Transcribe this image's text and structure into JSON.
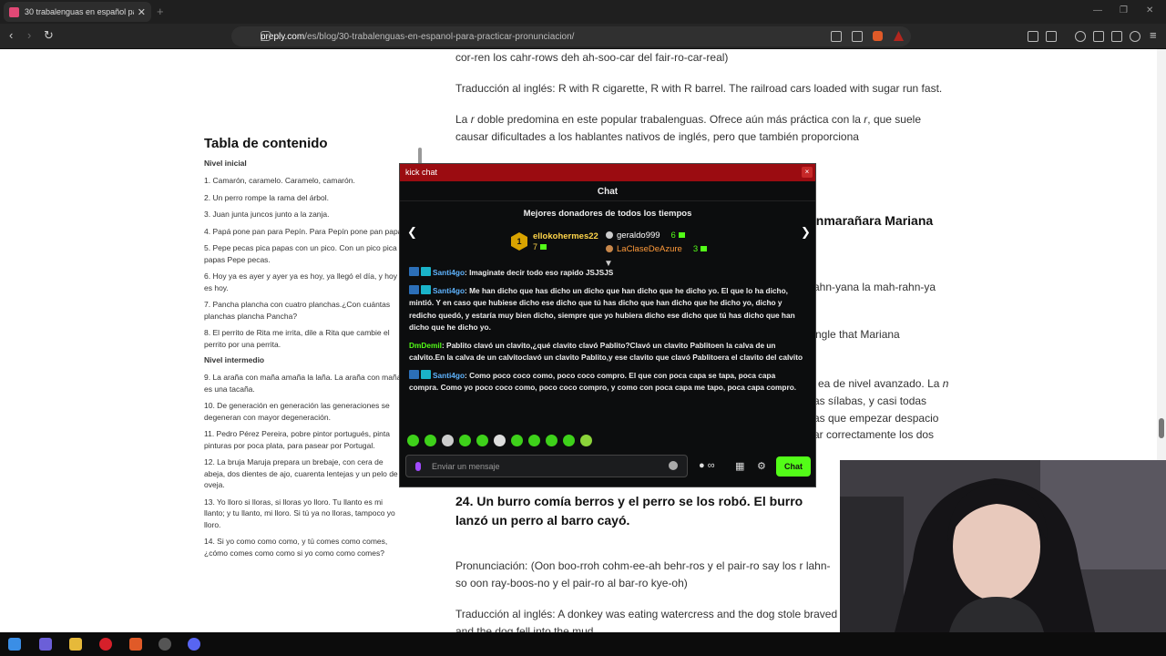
{
  "browser": {
    "tab_title": "30 trabalenguas en español para...",
    "url_domain": "preply.com",
    "url_path": "/es/blog/30-trabalenguas-en-espanol-para-practicar-pronunciacion/"
  },
  "toc": {
    "heading": "Tabla de contenido",
    "section1": "Nivel inicial",
    "items1": [
      "1. Camarón, caramelo. Caramelo, camarón.",
      "2. Un perro rompe la rama del árbol.",
      "3. Juan junta juncos junto a la zanja.",
      "4. Papá pone pan para Pepín. Para Pepín pone pan papá.",
      "5. Pepe pecas pica papas con un pico. Con un pico pica papas Pepe pecas.",
      "6. Hoy ya es ayer y ayer ya es hoy, ya llegó el día, y hoy es hoy.",
      "7. Pancha plancha con cuatro planchas.¿Con cuántas planchas plancha Pancha?",
      "8. El perrito de Rita me irrita, dile a Rita que cambie el perrito por una perrita."
    ],
    "section2": "Nivel intermedio",
    "items2": [
      "9. La araña con maña amaña la laña. La araña con maña es una tacaña.",
      "10. De generación en generación las generaciones se degeneran con mayor degeneración.",
      "11. Pedro Pérez Pereira, pobre pintor portugués, pinta pinturas por poca plata, para pasear por Portugal.",
      "12. La bruja Maruja prepara un brebaje, con cera de abeja, dos dientes de ajo, cuarenta lentejas y un pelo de oveja.",
      "13. Yo lloro si lloras, si lloras yo lloro. Tu llanto es mi llanto; y tu llanto, mi lloro. Si tú ya no lloras, tampoco yo lloro.",
      "14. Si yo como como como, y tú comes como comes, ¿cómo comes como como si yo como como comes?"
    ]
  },
  "article": {
    "p1": "cor-ren los cahr-rows deh ah-soo-car del fair-ro-car-real)",
    "p2": "Traducción al inglés: R with R cigarette, R with R barrel. The railroad cars loaded with sugar run fast.",
    "p3a": "La ",
    "p3b": "r",
    "p3c": " doble predomina en este popular trabalenguas. Ofrece aún más práctica con la ",
    "p3d": "r",
    "p3e": ", que suele causar dificultades a los hablantes nativos de inglés, pero que también proporciona",
    "frag_h": "enmarañara Mariana",
    "frag1": "ahn-yana la mah-rahn-ya",
    "frag2": "ngle that Mariana",
    "frag3a": "ea de nivel avanzado. La ",
    "frag3b": "n",
    "frag4": "as sílabas, y casi todas",
    "frag5": "as que empezar despacio",
    "frag6": "ar correctamente los dos",
    "h24": "24. Un burro comía berros y el perro se los robó. El burro lanzó un perro al barro cayó.",
    "pron": "Pronunciación: (Oon boo-rroh cohm-ee-ah behr-ros y el pair-ro say los r lahn-so oon ray-boos-no y el pair-ro al bar-ro kye-oh)",
    "trad": "Traducción al inglés: A donkey was eating watercress and the dog stole braved and the dog fell into the mud."
  },
  "chat": {
    "window_title": "kick chat",
    "close": "×",
    "header": "Chat",
    "donors_title": "Mejores donadores de todos los tiempos",
    "rank1": "1",
    "donor1_name": "ellokohermes22",
    "donor1_count": "7",
    "donor2_name": "geraldo999",
    "donor2_count": "6",
    "donor3_name": "LaClaseDeAzure",
    "donor3_count": "3",
    "messages": [
      {
        "user": "Santi4go",
        "text": ": Imaginate decir todo eso rapido JSJSJS"
      },
      {
        "user": "Santi4go",
        "text": ": Me han dicho que has dicho un dicho que han dicho que he dicho yo. El que lo ha dicho, mintió. Y en caso que hubiese dicho ese dicho que tú has dicho que han dicho que he dicho yo, dicho y redicho quedó, y estaría muy bien dicho, siempre que yo hubiera dicho ese dicho que tú has dicho que han dicho que he dicho yo."
      },
      {
        "user": "DmDemil",
        "text": ": Pablito clavó un clavito,¿qué clavito clavó Pablito?Clavó un clavito Pablitoen la calva de un calvito.En la calva de un calvitoclavó un clavito Pablito,y ese clavito que clavó Pablitoera el clavito del calvito"
      },
      {
        "user": "Santi4go",
        "text": ": Como poco coco como, poco coco compro. El que con poca capa se tapa, poca capa compra. Como yo poco coco como, poco coco compro, y como con poca capa me tapo, poca capa compro."
      }
    ],
    "input_placeholder": "Enviar un mensaje",
    "send_label": "Chat"
  }
}
